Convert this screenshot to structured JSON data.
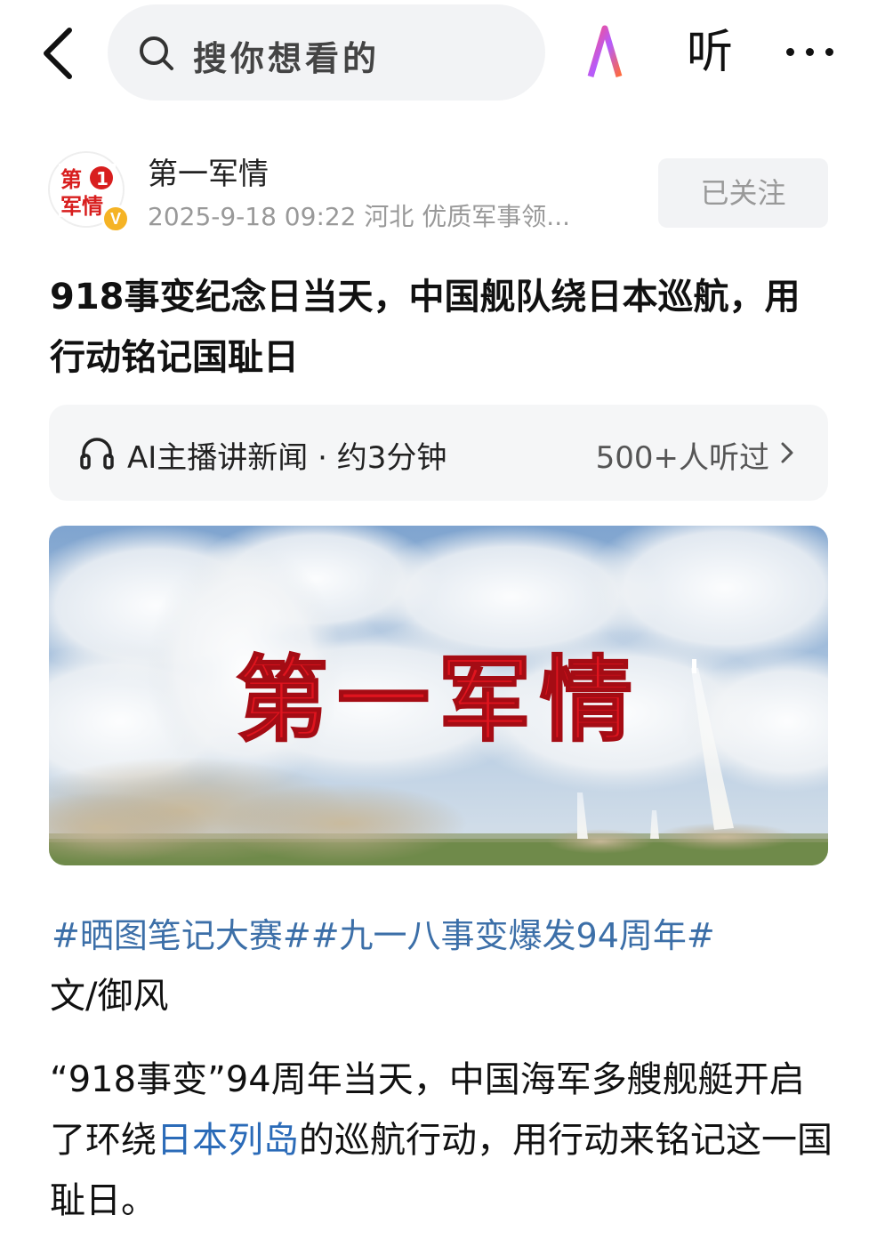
{
  "topbar": {
    "search_placeholder": "搜你想看的",
    "ai_label": "AI",
    "listen_label": "听"
  },
  "author": {
    "name": "第一军情",
    "avatar_text": "第1军情",
    "verified_label": "V",
    "meta": "2025-9-18  09:22  河北  优质军事领...",
    "follow_label": "已关注"
  },
  "article": {
    "headline": "918事变纪念日当天，中国舰队绕日本巡航，用行动铭记国耻日"
  },
  "listen_bar": {
    "label": "AI主播讲新闻 · 约3分钟",
    "count": "500+人听过"
  },
  "hero": {
    "overlay_text": "第一军情"
  },
  "body": {
    "tags": [
      "#晒图笔记大赛#",
      "#九一八事变爆发94周年#"
    ],
    "byline": "文/御风",
    "para_before": "“918事变”94周年当天，中国海军多艘舰艇开启了环绕",
    "para_link": "日本列岛",
    "para_after": "的巡航行动，用行动来铭记这一国耻日。"
  },
  "colors": {
    "tag": "#3c6fa8",
    "link": "#2b6bb8",
    "verified": "#f5b325",
    "hero_text": "#e0141e"
  }
}
